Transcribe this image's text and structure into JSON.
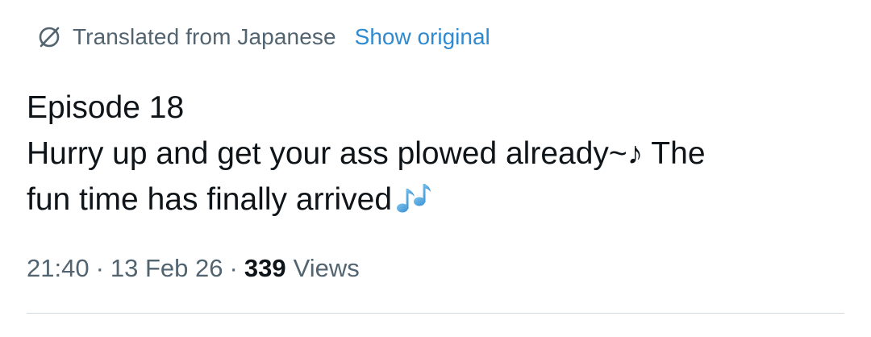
{
  "translation": {
    "label": "Translated from Japanese",
    "show_original": "Show original",
    "icon": "globe-translate-icon"
  },
  "tweet": {
    "line1": "Episode 18",
    "line2": "Hurry up and get your ass plowed already~♪ The",
    "line3": "fun time has finally arrived",
    "emoji": "multiple-musical-notes-icon"
  },
  "meta": {
    "time": "21:40",
    "date": "13 Feb 26",
    "separator": "·",
    "views_count": "339",
    "views_label": "Views"
  },
  "colors": {
    "text": "#0f1419",
    "muted": "#536471",
    "link": "#1d9bf0",
    "divider": "#cfd9de"
  }
}
